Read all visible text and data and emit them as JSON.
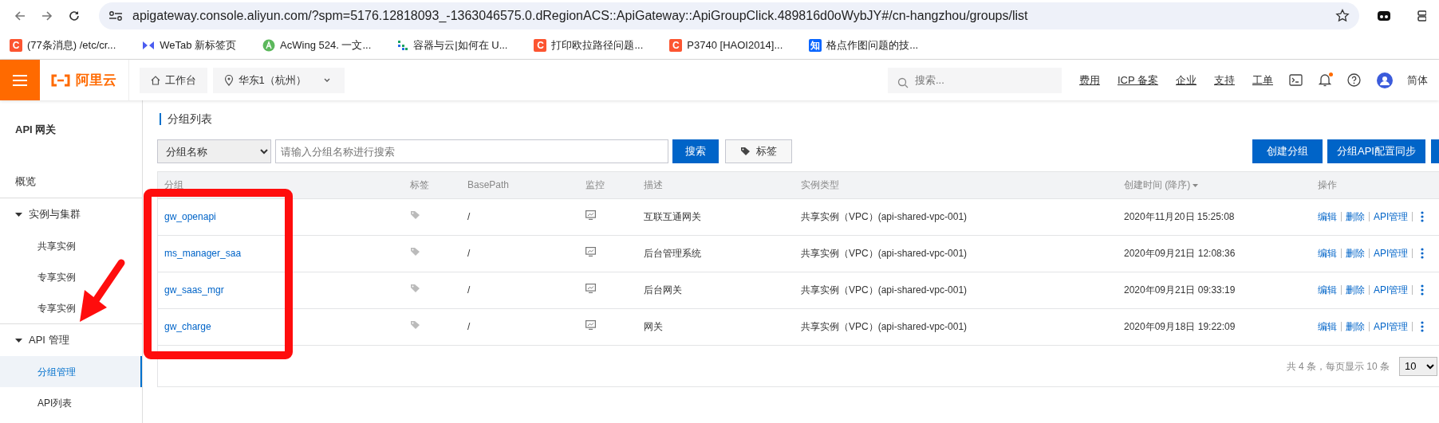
{
  "browser": {
    "url": "apigateway.console.aliyun.com/?spm=5176.12818093_-1363046575.0.dRegionACS::ApiGateway::ApiGroupClick.489816d0oWybJY#/cn-hangzhou/groups/list"
  },
  "bookmarks": [
    {
      "kind": "letter",
      "icon_text": "C",
      "color": "#fc5531",
      "label": "(77条消息) /etc/cr..."
    },
    {
      "kind": "wetab",
      "label": "WeTab 新标签页"
    },
    {
      "kind": "acwing",
      "label": "AcWing 524. 一文..."
    },
    {
      "kind": "dots",
      "label": "容器与云|如何在 U..."
    },
    {
      "kind": "letter",
      "icon_text": "C",
      "color": "#fc5531",
      "label": "打印欧拉路径问题..."
    },
    {
      "kind": "letter",
      "icon_text": "C",
      "color": "#fc5531",
      "label": "P3740 [HAOI2014]..."
    },
    {
      "kind": "letter",
      "icon_text": "知",
      "color": "#0a66ff",
      "label": "格点作图问题的技..."
    }
  ],
  "header": {
    "logo": "阿里云",
    "workbench": "工作台",
    "region": "华东1（杭州）",
    "search_placeholder": "搜索...",
    "links": [
      "费用",
      "ICP 备案",
      "企业",
      "支持",
      "工单"
    ],
    "unread_notifications": true,
    "language": "简体"
  },
  "sidebar": {
    "title": "API 网关",
    "items": [
      {
        "label": "概览",
        "selected": false
      },
      {
        "label": "实例与集群",
        "selected": false,
        "expanded": true,
        "children": [
          {
            "label": "共享实例",
            "selected": false
          },
          {
            "label": "专享实例",
            "selected": false
          },
          {
            "label": "专享实例",
            "selected": false
          }
        ]
      },
      {
        "label": "API 管理",
        "selected": false,
        "expanded": true,
        "children": [
          {
            "label": "分组管理",
            "selected": true
          },
          {
            "label": "API列表",
            "selected": false
          }
        ]
      }
    ]
  },
  "page": {
    "title": "分组列表",
    "filter": {
      "field": "分组名称",
      "placeholder": "请输入分组名称进行搜索",
      "search_button": "搜索",
      "tag_button": "标签"
    },
    "actions": [
      "创建分组",
      "分组API配置同步"
    ]
  },
  "table": {
    "columns": [
      {
        "label": "分组",
        "sorted": false
      },
      {
        "label": "标签",
        "sorted": false
      },
      {
        "label": "BasePath",
        "sorted": false
      },
      {
        "label": "监控",
        "sorted": false
      },
      {
        "label": "描述",
        "sorted": false
      },
      {
        "label": "实例类型",
        "sorted": false
      },
      {
        "label": "创建时间 (降序)",
        "sorted": true
      },
      {
        "label": "操作",
        "sorted": false
      }
    ],
    "rows": [
      {
        "name": "gw_openapi",
        "base_path": "/",
        "description": "互联互通网关",
        "instance": "共享实例（VPC）(api-shared-vpc-001)",
        "created": "2020年11月20日 15:25:08",
        "actions": [
          "编辑",
          "删除",
          "API管理"
        ]
      },
      {
        "name": "ms_manager_saa",
        "base_path": "/",
        "description": "后台管理系统",
        "instance": "共享实例（VPC）(api-shared-vpc-001)",
        "created": "2020年09月21日 12:08:36",
        "actions": [
          "编辑",
          "删除",
          "API管理"
        ]
      },
      {
        "name": "gw_saas_mgr",
        "base_path": "/",
        "description": "后台网关",
        "instance": "共享实例（VPC）(api-shared-vpc-001)",
        "created": "2020年09月21日 09:33:19",
        "actions": [
          "编辑",
          "删除",
          "API管理"
        ]
      },
      {
        "name": "gw_charge",
        "base_path": "/",
        "description": "网关",
        "instance": "共享实例（VPC）(api-shared-vpc-001)",
        "created": "2020年09月18日 19:22:09",
        "actions": [
          "编辑",
          "删除",
          "API管理"
        ]
      }
    ]
  },
  "pagination": {
    "summary": "共 4 条，每页显示 10 条",
    "page_size": "10"
  }
}
